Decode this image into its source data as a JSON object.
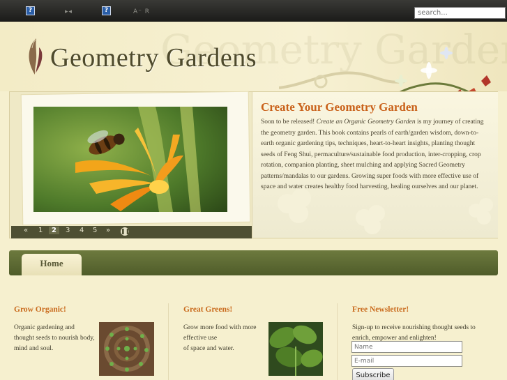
{
  "topbar": {
    "search_placeholder": "search...",
    "font_label": "A⁻ R"
  },
  "header": {
    "title": "Geometry Gardens",
    "watermark": "Geometry Gardens"
  },
  "feature": {
    "title": "Create Your Geometry Garden",
    "body_prefix": "Soon to be released! ",
    "body_emphasis": "Create an Organic Geometry Garden",
    "body_rest": " is my journey of creating the geometry garden. This book contains pearls of earth/garden wisdom, down-to-earth organic gardening tips, techniques, heart-to-heart insights, planting thought seeds of Feng Shui, permaculture/sustainable food production, inter-cropping, crop rotation, companion planting, sheet mulching and applying Sacred Geometry patterns/mandalas to our gardens. Growing super foods with more effective use of space and water creates healthy food harvesting, healing ourselves and our planet.",
    "pager": {
      "prev": "«",
      "pages": [
        "1",
        "2",
        "3",
        "4",
        "5"
      ],
      "active": "2",
      "next": "»"
    }
  },
  "nav": {
    "items": [
      {
        "label": "Home"
      }
    ]
  },
  "columns": {
    "grow": {
      "title": "Grow Organic!",
      "line1": "Organic gardening and",
      "line2": "thought seeds to nourish body,",
      "line3": "mind and soul."
    },
    "greens": {
      "title": "Great Greens!",
      "line1": "Grow more food with more",
      "line2": "effective use",
      "line3": "of space and water."
    },
    "newsletter": {
      "title": "Free Newsletter!",
      "line1": "Sign-up to receive nourishing thought seeds to",
      "line2": "enrich, empower and enlighten!",
      "name_placeholder": "Name",
      "email_placeholder": "E-mail",
      "button_label": "Subscribe"
    }
  },
  "colors": {
    "accent": "#c9611a",
    "nav": "#5c6a33",
    "pager": "#4e4f33"
  }
}
